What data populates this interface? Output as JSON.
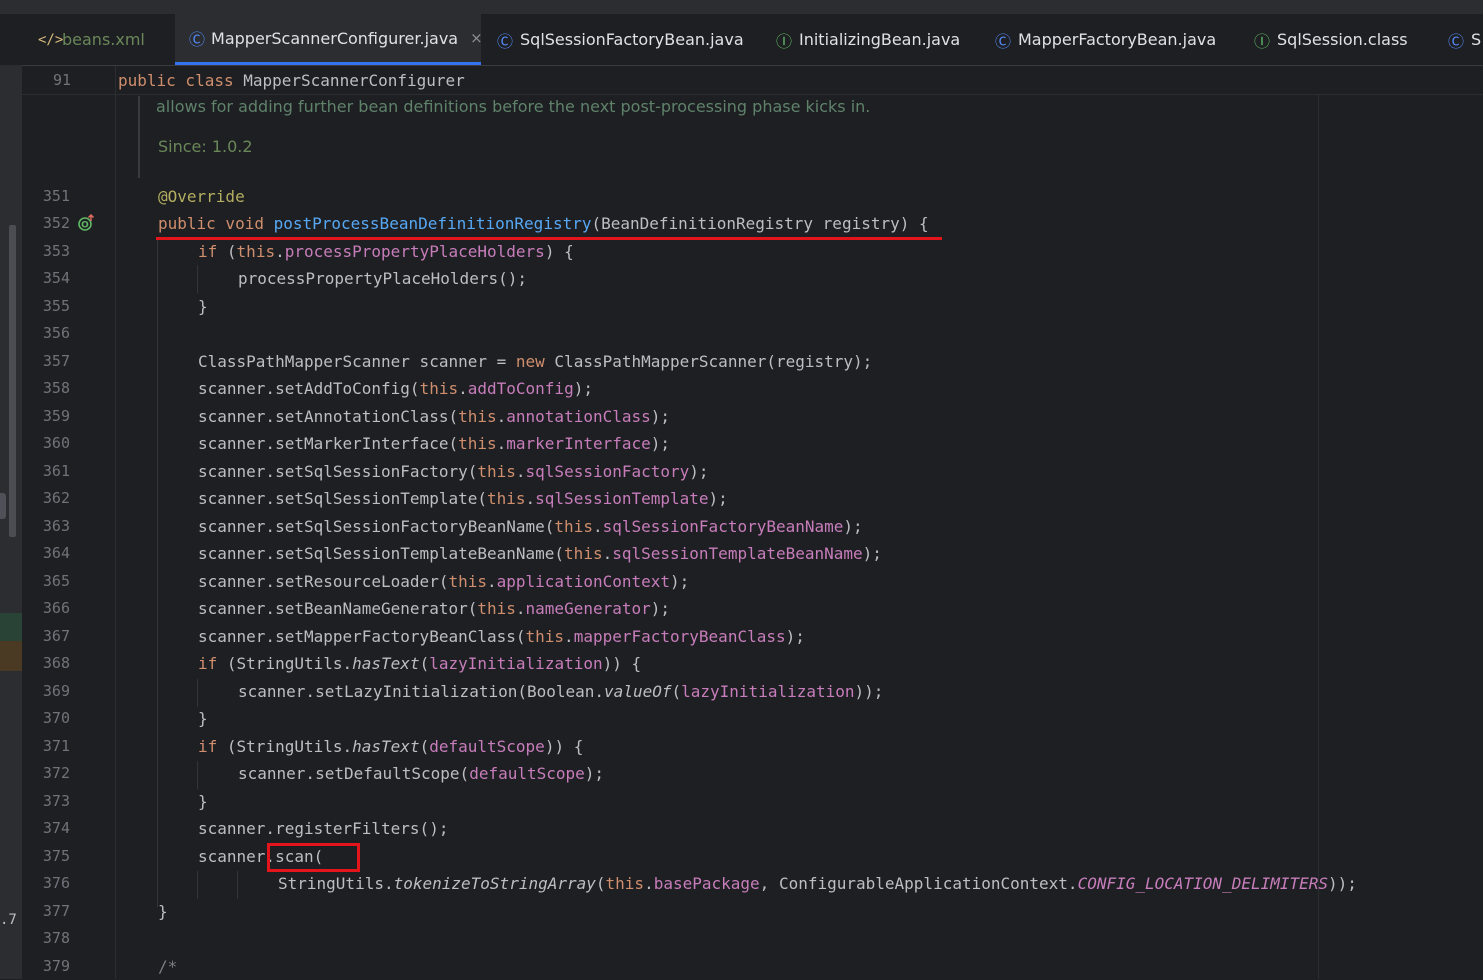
{
  "tabs": [
    {
      "label": "beans.xml",
      "icon": "xml-file-icon",
      "active": false
    },
    {
      "label": "MapperScannerConfigurer.java",
      "icon": "class-icon",
      "active": true,
      "close": "×"
    },
    {
      "label": "SqlSessionFactoryBean.java",
      "icon": "class-icon",
      "active": false
    },
    {
      "label": "InitializingBean.java",
      "icon": "interface-icon",
      "active": false
    },
    {
      "label": "MapperFactoryBean.java",
      "icon": "class-icon",
      "active": false
    },
    {
      "label": "SqlSession.class",
      "icon": "interface-icon",
      "active": false
    },
    {
      "label": "S",
      "icon": "class-icon",
      "active": false
    }
  ],
  "sticky_header": {
    "line_number": "91",
    "code_kw": "public class ",
    "code_name": "MapperScannerConfigurer"
  },
  "doc": {
    "text": "allows for adding further bean definitions before the next post-processing phase kicks in.",
    "since": "Since: 1.0.2"
  },
  "left_strip_number": ".7",
  "line_numbers": [
    "351",
    "352",
    "353",
    "354",
    "355",
    "356",
    "357",
    "358",
    "359",
    "360",
    "361",
    "362",
    "363",
    "364",
    "365",
    "366",
    "367",
    "368",
    "369",
    "370",
    "371",
    "372",
    "373",
    "374",
    "375",
    "376",
    "377",
    "378",
    "379"
  ],
  "code": {
    "l351": "@Override",
    "l352_kw": "public void ",
    "l352_fn": "postProcessBeanDefinitionRegistry",
    "l352_rest": "(BeanDefinitionRegistry registry) {",
    "l353_kw": "if ",
    "l353_a": "(",
    "l353_this": "this",
    "l353_dot": ".",
    "l353_fld": "processPropertyPlaceHolders",
    "l353_b": ") {",
    "l354": "processPropertyPlaceHolders();",
    "l355": "}",
    "l357_a": "ClassPathMapperScanner scanner = ",
    "l357_kw": "new ",
    "l357_b": "ClassPathMapperScanner(registry);",
    "l358_a": "scanner.setAddToConfig(",
    "l358_fld": "addToConfig",
    "l359_a": "scanner.setAnnotationClass(",
    "l359_fld": "annotationClass",
    "l360_a": "scanner.setMarkerInterface(",
    "l360_fld": "markerInterface",
    "l361_a": "scanner.setSqlSessionFactory(",
    "l361_fld": "sqlSessionFactory",
    "l362_a": "scanner.setSqlSessionTemplate(",
    "l362_fld": "sqlSessionTemplate",
    "l363_a": "scanner.setSqlSessionFactoryBeanName(",
    "l363_fld": "sqlSessionFactoryBeanName",
    "l364_a": "scanner.setSqlSessionTemplateBeanName(",
    "l364_fld": "sqlSessionTemplateBeanName",
    "l365_a": "scanner.setResourceLoader(",
    "l365_fld": "applicationContext",
    "l366_a": "scanner.setBeanNameGenerator(",
    "l366_fld": "nameGenerator",
    "l367_a": "scanner.setMapperFactoryBeanClass(",
    "l367_fld": "mapperFactoryBeanClass",
    "this": "this",
    "dot": ".",
    "close_paren_semi": ");",
    "l368_kw": "if ",
    "l368_a": "(StringUtils.",
    "l368_it": "hasText",
    "l368_b": "(",
    "l368_fld": "lazyInitialization",
    "l368_c": ")) {",
    "l369_a": "scanner.setLazyInitialization(Boolean.",
    "l369_it": "valueOf",
    "l369_b": "(",
    "l369_fld": "lazyInitialization",
    "l369_c": "));",
    "l370": "}",
    "l371_kw": "if ",
    "l371_a": "(StringUtils.",
    "l371_it": "hasText",
    "l371_b": "(",
    "l371_fld": "defaultScope",
    "l371_c": ")) {",
    "l372_a": "scanner.setDefaultScope(",
    "l372_fld": "defaultScope",
    "l372_b": ");",
    "l373": "}",
    "l374": "scanner.registerFilters();",
    "l375": "scanner.scan(",
    "l376_a": "StringUtils.",
    "l376_it": "tokenizeToStringArray",
    "l376_b": "(",
    "l376_this": "this",
    "l376_dot": ".",
    "l376_fld": "basePackage",
    "l376_c": ", ConfigurableApplicationContext.",
    "l376_stat": "CONFIG_LOCATION_DELIMITERS",
    "l376_d": "));",
    "l377": "}",
    "l379": "/*"
  },
  "colors": {
    "background": "#1e1f22",
    "keyword": "#cf8e6d",
    "field": "#c77dbb",
    "method": "#56a8f5",
    "annotation": "#b3ae60",
    "doc": "#5f826b",
    "highlight": "#e3151a",
    "active_tab_underline": "#3574f0"
  }
}
